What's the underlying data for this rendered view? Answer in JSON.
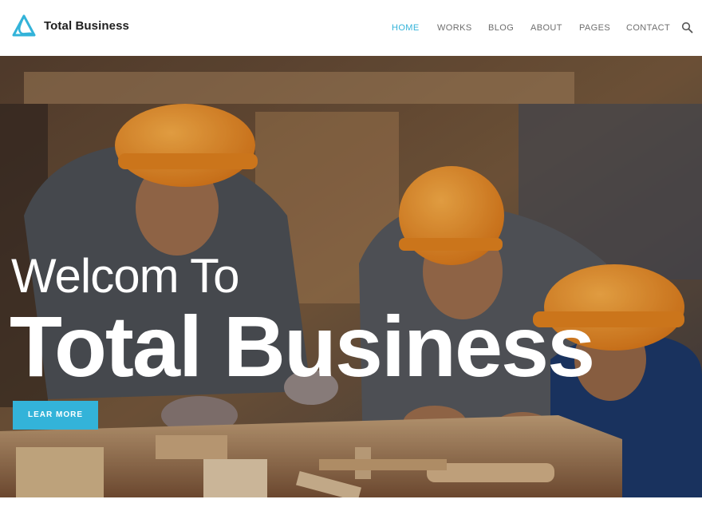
{
  "brand": {
    "name": "Total Business",
    "accent_color": "#33b3d9",
    "logo_icon": "triangle-loop-logo-icon"
  },
  "nav": {
    "items": [
      {
        "label": "HOME",
        "active": true
      },
      {
        "label": "WORKS",
        "active": false
      },
      {
        "label": "BLOG",
        "active": false
      },
      {
        "label": "ABOUT",
        "active": false
      },
      {
        "label": "PAGES",
        "active": false
      },
      {
        "label": "CONTACT",
        "active": false
      }
    ],
    "search_icon": "search-icon"
  },
  "hero": {
    "welcome": "Welcom To",
    "title": "Total Business",
    "cta_label": "LEAR MORE",
    "image_subject": "construction-workers-photo"
  }
}
